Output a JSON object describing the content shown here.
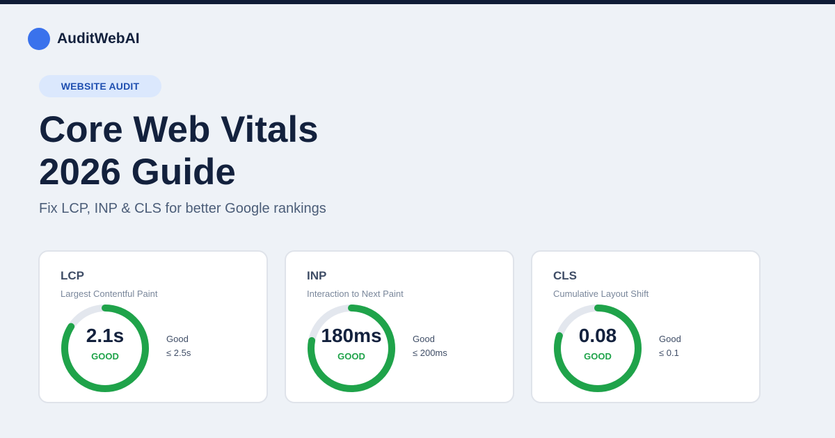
{
  "brand": {
    "name": "AuditWebAI"
  },
  "badge": "WEBSITE AUDIT",
  "title": {
    "line1": "Core Web Vitals",
    "line2": "2026 Guide"
  },
  "subtitle": "Fix LCP, INP & CLS for better Google rankings",
  "colors": {
    "brand_dot": "#3a72ec",
    "good": "#1fa34a",
    "track": "#e3e7ee",
    "text_dark": "#13213d"
  },
  "metrics": [
    {
      "abbr": "LCP",
      "name": "Largest Contentful Paint",
      "value": "2.1s",
      "status": "GOOD",
      "legend_label": "Good",
      "threshold": "≤ 2.5s",
      "fill_fraction": 0.84
    },
    {
      "abbr": "INP",
      "name": "Interaction to Next Paint",
      "value": "180ms",
      "status": "GOOD",
      "legend_label": "Good",
      "threshold": "≤ 200ms",
      "fill_fraction": 0.78
    },
    {
      "abbr": "CLS",
      "name": "Cumulative Layout Shift",
      "value": "0.08",
      "status": "GOOD",
      "legend_label": "Good",
      "threshold": "≤ 0.1",
      "fill_fraction": 0.8
    }
  ]
}
